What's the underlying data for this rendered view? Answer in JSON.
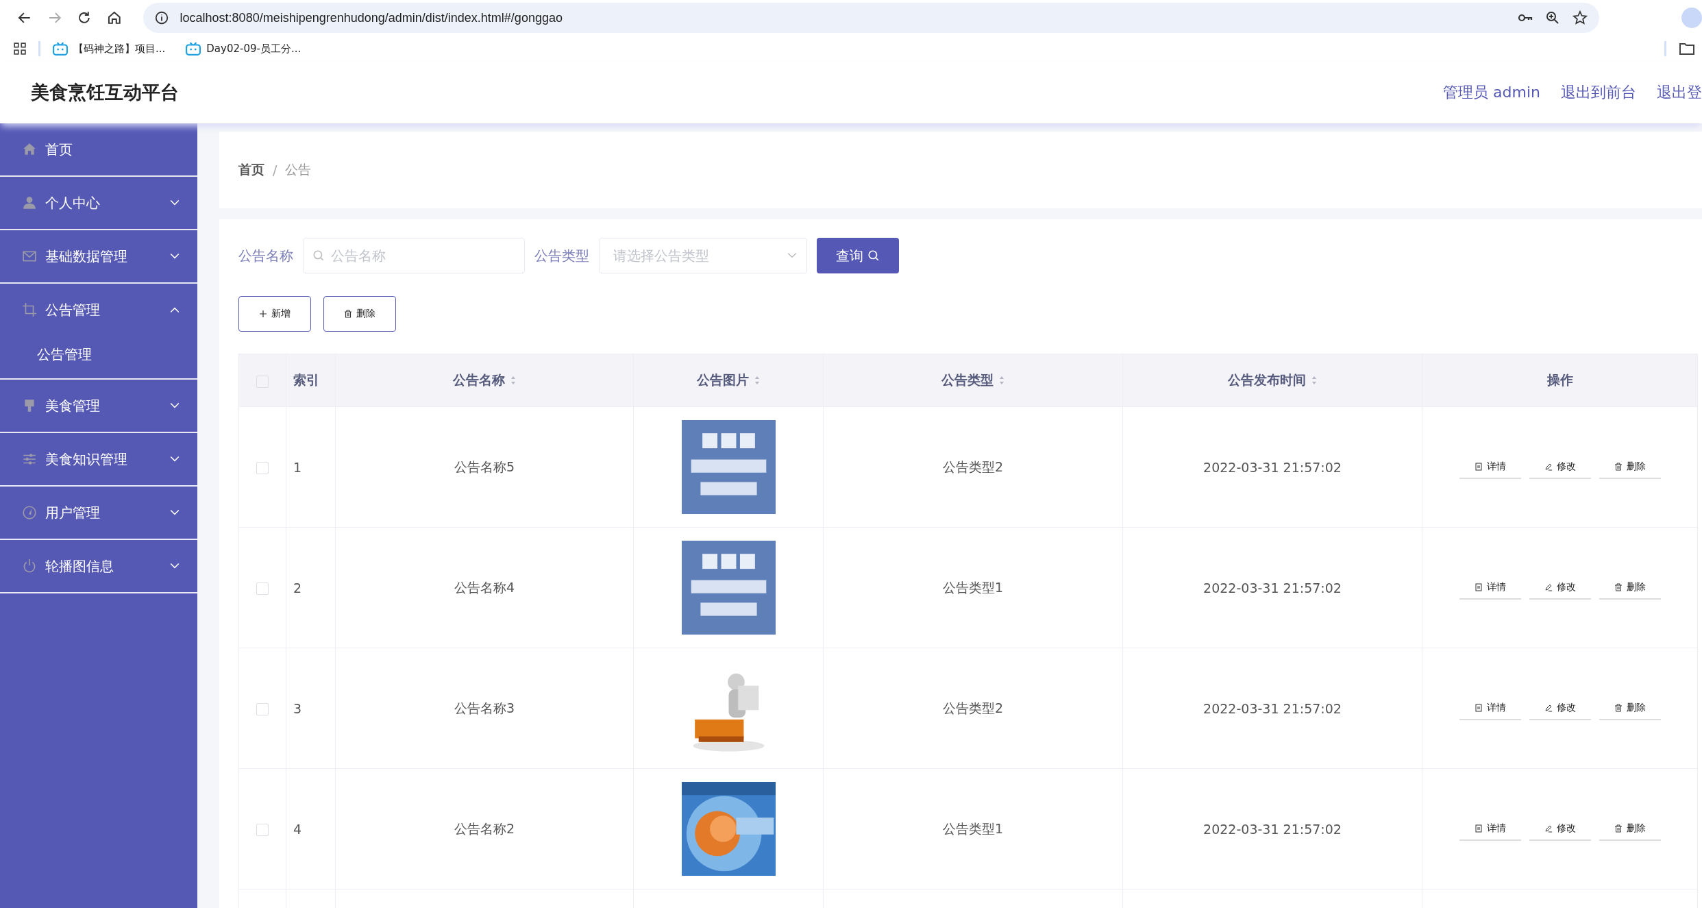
{
  "browser": {
    "url": "localhost:8080/meishipengrenhudong/admin/dist/index.html#/gonggao",
    "bookmarks": [
      "【码神之路】项目...",
      "Day02-09-员工分..."
    ]
  },
  "header": {
    "title": "美食烹饪互动平台",
    "links": [
      "管理员 admin",
      "退出到前台",
      "退出登"
    ]
  },
  "sidebar": {
    "items": [
      {
        "label": "首页",
        "kind": "link"
      },
      {
        "label": "个人中心",
        "kind": "submenu",
        "expanded": false
      },
      {
        "label": "基础数据管理",
        "kind": "submenu",
        "expanded": false
      },
      {
        "label": "公告管理",
        "kind": "submenu",
        "expanded": true,
        "children": [
          {
            "label": "公告管理"
          }
        ]
      },
      {
        "label": "美食管理",
        "kind": "submenu",
        "expanded": false
      },
      {
        "label": "美食知识管理",
        "kind": "submenu",
        "expanded": false
      },
      {
        "label": "用户管理",
        "kind": "submenu",
        "expanded": false
      },
      {
        "label": "轮播图信息",
        "kind": "submenu",
        "expanded": false
      }
    ]
  },
  "breadcrumb": [
    "首页",
    "/",
    "公告"
  ],
  "search": {
    "fields": [
      {
        "label": "公告名称",
        "placeholder": "公告名称",
        "kind": "text"
      },
      {
        "label": "公告类型",
        "placeholder": "请选择公告类型",
        "kind": "select"
      }
    ],
    "button": "查询"
  },
  "actions": [
    {
      "label": "新增",
      "kind": "add"
    },
    {
      "label": "删除",
      "kind": "delete"
    }
  ],
  "table": {
    "all_checked": false,
    "columns": [
      {
        "label": "索引",
        "sortable": false
      },
      {
        "label": "公告名称",
        "sortable": true
      },
      {
        "label": "公告图片",
        "sortable": true
      },
      {
        "label": "公告类型",
        "sortable": true
      },
      {
        "label": "公告发布时间",
        "sortable": true
      },
      {
        "label": "操作",
        "sortable": false
      }
    ],
    "rows": [
      {
        "checked": false,
        "index": "1",
        "name": "公告名称5",
        "picture": {
          "kind": "picture"
        },
        "type": "公告类型2",
        "time": "2022-03-31 21:57:02",
        "actions": [
          "详情",
          "修改",
          "删除"
        ]
      },
      {
        "checked": false,
        "index": "2",
        "name": "公告名称4",
        "picture": {
          "kind": "picture"
        },
        "type": "公告类型1",
        "time": "2022-03-31 21:57:02",
        "actions": [
          "详情",
          "修改",
          "删除"
        ]
      },
      {
        "checked": false,
        "index": "3",
        "name": "公告名称3",
        "picture": {
          "kind": "picture"
        },
        "type": "公告类型2",
        "time": "2022-03-31 21:57:02",
        "actions": [
          "详情",
          "修改",
          "删除"
        ]
      },
      {
        "checked": false,
        "index": "4",
        "name": "公告名称2",
        "picture": {
          "kind": "picture"
        },
        "type": "公告类型1",
        "time": "2022-03-31 21:57:02",
        "actions": [
          "详情",
          "修改",
          "删除"
        ]
      }
    ]
  }
}
